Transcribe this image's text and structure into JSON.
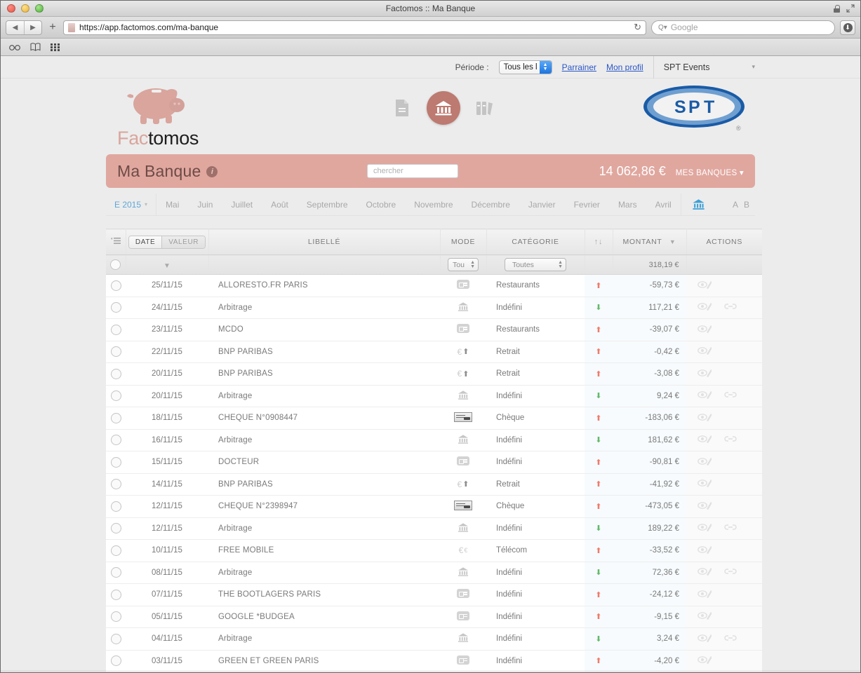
{
  "browser": {
    "window_title": "Factomos :: Ma Banque",
    "url": "https://app.factomos.com/ma-banque",
    "search_placeholder": "Google",
    "reload_glyph": "↻",
    "back_glyph": "◀",
    "forward_glyph": "▶",
    "plus_glyph": "+",
    "search_glyph": "Q▾",
    "download_glyph": "⬇"
  },
  "topnav": {
    "periode_label": "Période :",
    "periode_value": "Tous les l",
    "links": [
      "Parrainer",
      "Mon profil"
    ],
    "account": "SPT Events",
    "account_caret": "▾"
  },
  "brand": {
    "logo_fac": "Fac",
    "logo_tomos": "tomos",
    "nav_icons": [
      "document-icon",
      "bank-icon",
      "binders-icon"
    ],
    "spt": {
      "letters": [
        "S",
        "P",
        "T"
      ],
      "registered": "®"
    }
  },
  "banner": {
    "title": "Ma Banque",
    "info": "i",
    "search_placeholder": "chercher",
    "total": "14 062,86 €",
    "banks_label": "MES BANQUES ▾"
  },
  "months": {
    "year": "E 2015",
    "year_caret": "▾",
    "items": [
      "Mai",
      "Juin",
      "Juillet",
      "Août",
      "Septembre",
      "Octobre",
      "Novembre",
      "Décembre",
      "Janvier",
      "Fevrier",
      "Mars",
      "Avril"
    ],
    "bank_icon": "bank-icon",
    "ab": [
      "A",
      "B"
    ]
  },
  "table": {
    "headers": {
      "filter_icon": "filter-icon",
      "date": "DATE",
      "valeur": "VALEUR",
      "libelle": "LIBELLÉ",
      "mode": "MODE",
      "categorie": "CATÉGORIE",
      "arrows": "↑↓",
      "montant": "MONTANT",
      "montant_sort": "▼",
      "actions": "ACTIONS"
    },
    "filter_row": {
      "date_sort": "▼",
      "mode_select": "Tou",
      "cat_select": "Toutes",
      "total": "318,19 €"
    },
    "rows": [
      {
        "date": "25/11/15",
        "libelle": "ALLORESTO.FR PARIS",
        "mode": "cb",
        "categorie": "Restaurants",
        "dir": "up",
        "montant": "-59,73 €",
        "sign": "neg",
        "link": false
      },
      {
        "date": "24/11/15",
        "libelle": "Arbitrage",
        "mode": "bank",
        "categorie": "Indéfini",
        "dir": "down",
        "montant": "117,21 €",
        "sign": "pos",
        "link": true
      },
      {
        "date": "23/11/15",
        "libelle": "MCDO",
        "mode": "cb",
        "categorie": "Restaurants",
        "dir": "up",
        "montant": "-39,07 €",
        "sign": "neg",
        "link": false
      },
      {
        "date": "22/11/15",
        "libelle": "BNP PARIBAS",
        "mode": "eur",
        "categorie": "Retrait",
        "dir": "up",
        "montant": "-0,42 €",
        "sign": "neg",
        "link": false
      },
      {
        "date": "20/11/15",
        "libelle": "BNP PARIBAS",
        "mode": "eur",
        "categorie": "Retrait",
        "dir": "up",
        "montant": "-3,08 €",
        "sign": "neg",
        "link": false
      },
      {
        "date": "20/11/15",
        "libelle": "Arbitrage",
        "mode": "bank",
        "categorie": "Indéfini",
        "dir": "down",
        "montant": "9,24 €",
        "sign": "pos",
        "link": true
      },
      {
        "date": "18/11/15",
        "libelle": "CHEQUE N°0908447",
        "mode": "cheque",
        "categorie": "Chèque",
        "dir": "up",
        "montant": "-183,06 €",
        "sign": "neg",
        "link": false
      },
      {
        "date": "16/11/15",
        "libelle": "Arbitrage",
        "mode": "bank",
        "categorie": "Indéfini",
        "dir": "down",
        "montant": "181,62 €",
        "sign": "pos",
        "link": true
      },
      {
        "date": "15/11/15",
        "libelle": "DOCTEUR",
        "mode": "cb",
        "categorie": "Indéfini",
        "dir": "up",
        "montant": "-90,81 €",
        "sign": "neg",
        "link": false
      },
      {
        "date": "14/11/15",
        "libelle": "BNP PARIBAS",
        "mode": "eur",
        "categorie": "Retrait",
        "dir": "up",
        "montant": "-41,92 €",
        "sign": "neg",
        "link": false
      },
      {
        "date": "12/11/15",
        "libelle": "CHEQUE N°2398947",
        "mode": "cheque",
        "categorie": "Chèque",
        "dir": "up",
        "montant": "-473,05 €",
        "sign": "neg",
        "link": false
      },
      {
        "date": "12/11/15",
        "libelle": "Arbitrage",
        "mode": "bank",
        "categorie": "Indéfini",
        "dir": "down",
        "montant": "189,22 €",
        "sign": "pos",
        "link": true
      },
      {
        "date": "10/11/15",
        "libelle": "FREE MOBILE",
        "mode": "eur2",
        "categorie": "Télécom",
        "dir": "up",
        "montant": "-33,52 €",
        "sign": "neg",
        "link": false
      },
      {
        "date": "08/11/15",
        "libelle": "Arbitrage",
        "mode": "bank",
        "categorie": "Indéfini",
        "dir": "down",
        "montant": "72,36 €",
        "sign": "pos",
        "link": true
      },
      {
        "date": "07/11/15",
        "libelle": "THE BOOTLAGERS PARIS",
        "mode": "cb",
        "categorie": "Indéfini",
        "dir": "up",
        "montant": "-24,12 €",
        "sign": "neg",
        "link": false
      },
      {
        "date": "05/11/15",
        "libelle": "GOOGLE *BUDGEA",
        "mode": "cb",
        "categorie": "Indéfini",
        "dir": "up",
        "montant": "-9,15 €",
        "sign": "neg",
        "link": false
      },
      {
        "date": "04/11/15",
        "libelle": "Arbitrage",
        "mode": "bank",
        "categorie": "Indéfini",
        "dir": "down",
        "montant": "3,24 €",
        "sign": "pos",
        "link": true
      },
      {
        "date": "03/11/15",
        "libelle": "GREEN ET GREEN PARIS",
        "mode": "cb",
        "categorie": "Indéfini",
        "dir": "up",
        "montant": "-4,20 €",
        "sign": "neg",
        "link": false
      }
    ]
  },
  "colors": {
    "banner_pink": "#e0a79f",
    "accent_brown": "#bd7a70",
    "link_blue": "#2a56c6",
    "month_blue": "#5da7d8",
    "negative": "#b03b3b",
    "positive": "#2f7a3e"
  }
}
